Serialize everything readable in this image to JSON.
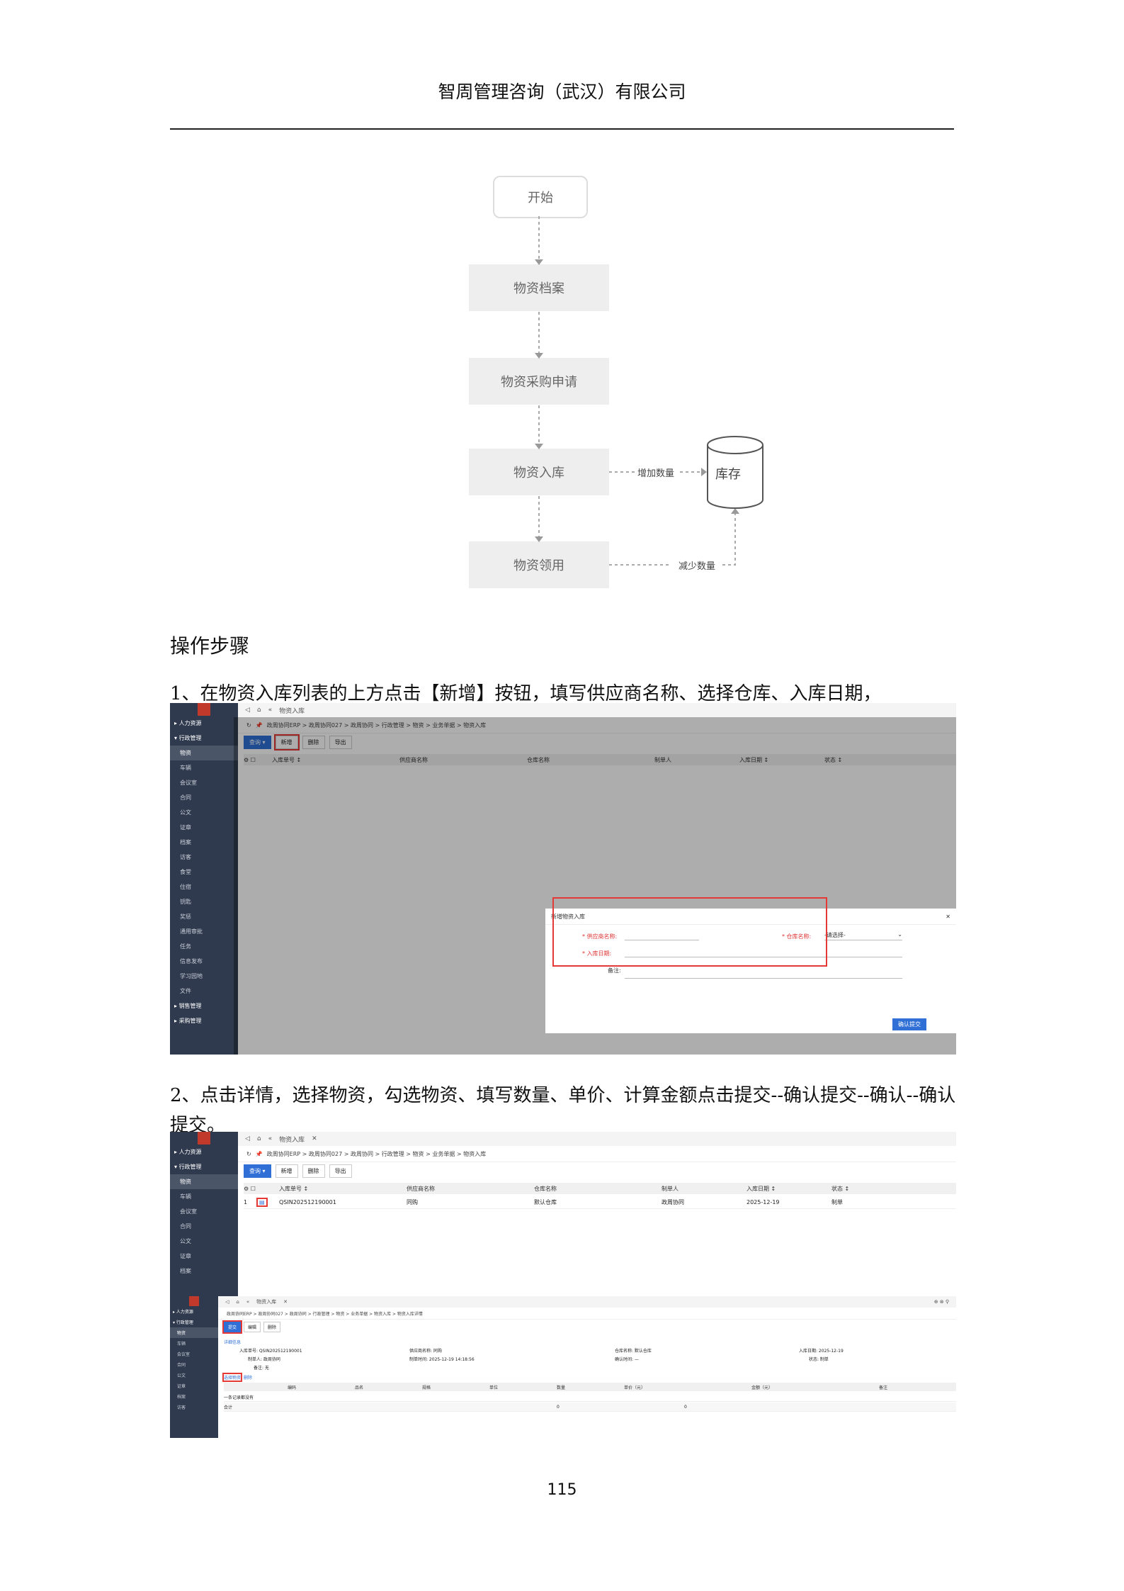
{
  "header": {
    "company": "智周管理咨询（武汉）有限公司"
  },
  "flow": {
    "start": "开始",
    "nodes": [
      "物资档案",
      "物资采购申请",
      "物资入库",
      "物资领用"
    ],
    "storage": "库存",
    "increase_label": "增加数量",
    "decrease_label": "减少数量"
  },
  "section_title": "操作步骤",
  "steps": {
    "step1": "1、在物资入库列表的上方点击【新增】按钮，填写供应商名称、选择仓库、入库日期，",
    "step2": "2、点击详情，选择物资，勾选物资、填写数量、单价、计算金额点击提交--确认提交--确认--确认提交。"
  },
  "app": {
    "sidebar_groups": [
      "人力资源",
      "行政管理",
      "销售管理",
      "采购管理"
    ],
    "sidebar_items": [
      "物资",
      "车辆",
      "会议室",
      "合同",
      "公文",
      "证章",
      "档案",
      "访客",
      "食堂",
      "住宿",
      "钥匙",
      "奖惩",
      "通用审批",
      "任务",
      "信息发布",
      "学习园地",
      "文件"
    ],
    "tab": "物资入库",
    "breadcrumb": "政周协同ERP > 政周协同027 > 政周协同 > 行政管理 > 物资 > 业务单据 > 物资入库",
    "breadcrumb_detail": "政周协同ERP > 政周协同027 > 政周协同 > 行政管理 > 物资 > 业务单据 > 物资入库 > 物资入库详情",
    "btn_query": "查询",
    "btn_add": "新增",
    "btn_delete": "删除",
    "btn_export": "导出",
    "columns": [
      "入库单号 ↕",
      "供应商名称",
      "仓库名称",
      "制单人",
      "入库日期 ↕",
      "状态 ↕"
    ],
    "row": {
      "no": "1",
      "order": "QSIN202512190001",
      "supplier": "同购",
      "warehouse": "默认仓库",
      "creator": "政周协同",
      "date": "2025-12-19",
      "status": "制单"
    },
    "dialog": {
      "title": "新增物资入库",
      "supplier_label": "* 供应商名称:",
      "warehouse_label": "* 仓库名称:",
      "warehouse_value": "-请选择-",
      "date_label": "* 入库日期:",
      "remark_label": "备注:",
      "confirm": "确认提交"
    },
    "detail": {
      "btn_submit": "提交",
      "btn_edit": "编辑",
      "btn_delete": "删除",
      "section": "详细信息",
      "f1": "入库单号: QSIN202512190001",
      "f2": "供应商名称: 同购",
      "f3": "仓库名称: 默认仓库",
      "f4": "入库日期: 2025-12-19",
      "f5": "制单人: 政周协同",
      "f6": "制单时间: 2025-12-19 14:18:56",
      "f7": "确认时间: —",
      "f8": "状态: 制单",
      "f9": "备注: 无",
      "links": [
        "选择物资",
        "删除"
      ],
      "cols": [
        "编码",
        "品名",
        "规格",
        "单位",
        "数量",
        "单价（元）",
        "金额（元）",
        "备注"
      ],
      "empty": "一条记录都没有",
      "total_label": "合计",
      "total_qty": "0",
      "total_amount": "0"
    }
  },
  "page_number": "115"
}
